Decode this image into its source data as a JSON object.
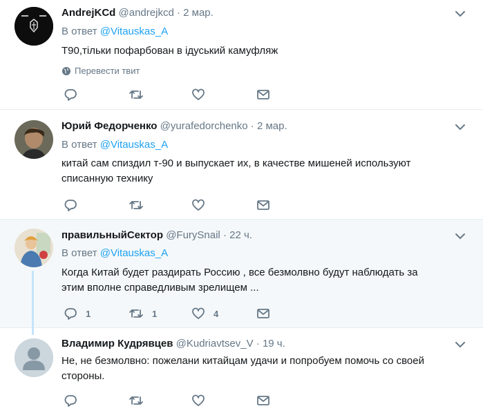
{
  "reply_prefix": "В ответ",
  "translate_label": "Перевести твит",
  "tweets": [
    {
      "name": "AndrejKCd",
      "handle": "@andrejkcd",
      "time": "2 мар.",
      "reply_to": "@Vitauskas_A",
      "lines": [
        "Т90,тільки пофарбован в ідуський камуфляж"
      ],
      "replies": "",
      "retweets": "",
      "likes": ""
    },
    {
      "name": "Юрий Федорченко",
      "handle": "@yurafedorchenko",
      "time": "2 мар.",
      "reply_to": "@Vitauskas_A",
      "lines": [
        "китай сам спиздил т-90 и выпускает их, в качестве мишеней используют",
        "списанную технику"
      ],
      "replies": "",
      "retweets": "",
      "likes": ""
    },
    {
      "name": "правильныйСектор",
      "handle": "@FurySnail",
      "time": "22 ч.",
      "reply_to": "@Vitauskas_A",
      "lines": [
        "Когда Китай будет раздирать Россию , все безмолвно будут наблюдать за",
        "этим вполне справедливым зрелищем ..."
      ],
      "replies": "1",
      "retweets": "1",
      "likes": "4"
    },
    {
      "name": "Владимир Кудрявцев",
      "handle": "@Kudriavtsev_V",
      "time": "19 ч.",
      "reply_to": "",
      "lines": [
        "Не, не безмолвно: пожелани китайцам удачи и попробуем помочь со своей",
        "стороны."
      ],
      "replies": "",
      "retweets": "",
      "likes": ""
    }
  ],
  "colors": {
    "link": "#1da1f2",
    "muted": "#657786",
    "highlight_bg": "#f5f8fa",
    "thread_line": "#c4e4fb"
  }
}
